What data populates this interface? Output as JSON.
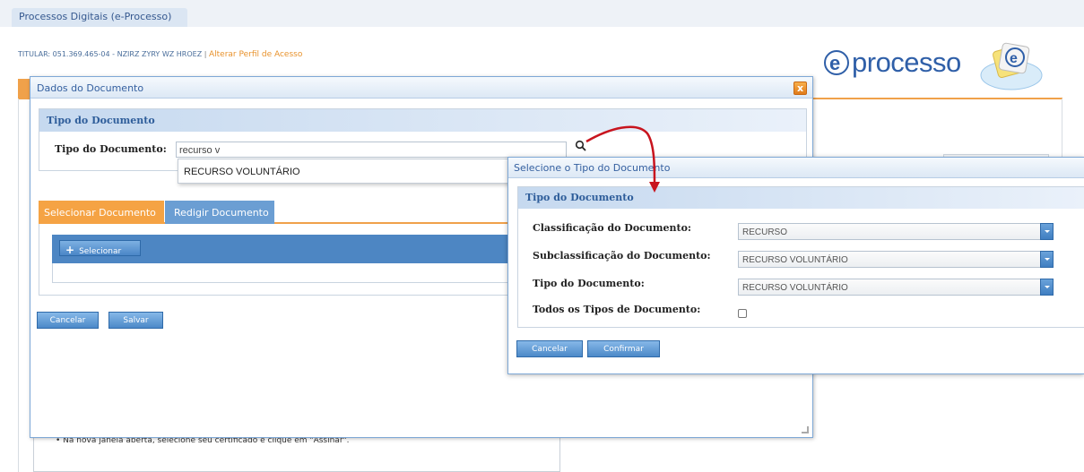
{
  "app": {
    "top_tab": "Processos Digitais (e-Processo)",
    "titular_label": "TITULAR: 051.369.465-04 - NZIRZ ZYRY WZ HROEZ",
    "separator": "|",
    "alterar_perfil": "Alterar Perfil de Acesso",
    "logo_prefix": "e",
    "logo_text": "processo"
  },
  "base": {
    "bullet_text": "Na nova janela aberta, selecione seu certificado e clique em \"Assinar\"."
  },
  "dialog_dados": {
    "title": "Dados do Documento",
    "close_glyph": "x",
    "section_title": "Tipo do Documento",
    "tipo_label": "Tipo do Documento:",
    "tipo_value": "recurso v",
    "autocomplete_option": "RECURSO VOLUNTÁRIO",
    "tabs": [
      {
        "label": "Selecionar Documento",
        "active": true
      },
      {
        "label": "Redigir Documento",
        "active": false
      }
    ],
    "selecionar_label": "Selecionar",
    "cancelar_label": "Cancelar",
    "salvar_label": "Salvar"
  },
  "dialog_tipo": {
    "title": "Selecione o Tipo do Documento",
    "section_title": "Tipo do Documento",
    "fields": [
      {
        "label": "Classificação do Documento:",
        "value": "RECURSO"
      },
      {
        "label": "Subclassificação do Documento:",
        "value": "RECURSO VOLUNTÁRIO"
      },
      {
        "label": "Tipo do Documento:",
        "value": "RECURSO VOLUNTÁRIO"
      }
    ],
    "todos_label": "Todos os Tipos de Documento:",
    "todos_checked": false,
    "cancelar_label": "Cancelar",
    "confirmar_label": "Confirmar"
  },
  "colors": {
    "accent_orange": "#f0a14a",
    "accent_blue": "#4d86c3",
    "annotation_red": "#c8141e"
  }
}
